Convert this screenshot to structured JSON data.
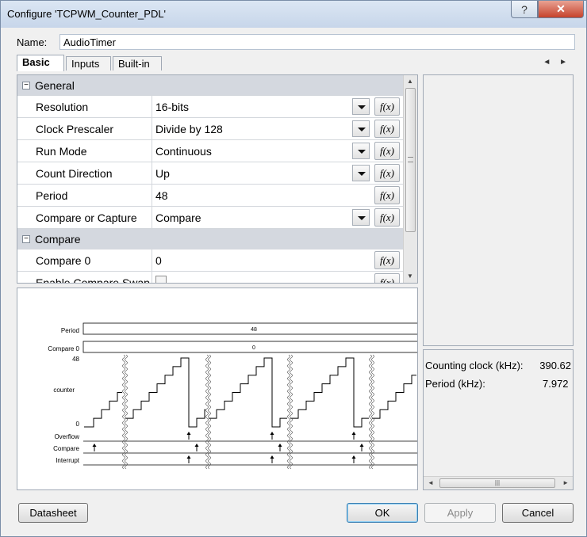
{
  "window": {
    "title": "Configure 'TCPWM_Counter_PDL'",
    "help_glyph": "?",
    "close_glyph": "✕"
  },
  "name": {
    "label": "Name:",
    "value": "AudioTimer"
  },
  "tabs": [
    {
      "label": "Basic",
      "active": true
    },
    {
      "label": "Inputs",
      "active": false
    },
    {
      "label": "Built-in",
      "active": false
    }
  ],
  "tab_scroll": "◄ ►",
  "params": {
    "general_label": "General",
    "compare_label": "Compare",
    "fx_label": "f(x)",
    "rows": [
      {
        "name": "Resolution",
        "value": "16-bits",
        "dropdown": true
      },
      {
        "name": "Clock Prescaler",
        "value": "Divide by 128",
        "dropdown": true
      },
      {
        "name": "Run Mode",
        "value": "Continuous",
        "dropdown": true
      },
      {
        "name": "Count Direction",
        "value": "Up",
        "dropdown": true
      },
      {
        "name": "Period",
        "value": "48",
        "dropdown": false
      },
      {
        "name": "Compare or Capture",
        "value": "Compare",
        "dropdown": true
      }
    ],
    "compare_rows": [
      {
        "name": "Compare 0",
        "value": "0"
      },
      {
        "name": "Enable Compare Swap",
        "checked": false
      }
    ]
  },
  "diagram": {
    "period_label": "Period",
    "period_value": "48",
    "compare0_label": "Compare 0",
    "compare0_value": "0",
    "counter_max": "48",
    "counter_label": "counter",
    "counter_min": "0",
    "overflow_label": "Overflow",
    "compare_label": "Compare",
    "interrupt_label": "Interrupt"
  },
  "info": {
    "counting_clock_label": "Counting clock (kHz):",
    "counting_clock_value": "390.62",
    "period_label": "Period (kHz):",
    "period_value": "7.972"
  },
  "buttons": {
    "datasheet": "Datasheet",
    "ok": "OK",
    "apply": "Apply",
    "cancel": "Cancel"
  }
}
